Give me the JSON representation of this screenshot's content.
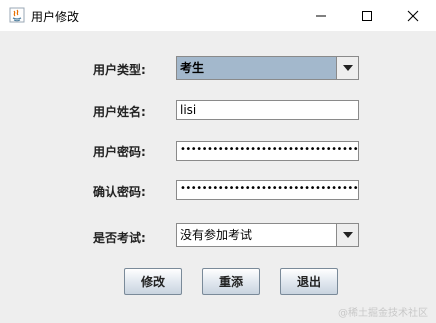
{
  "window": {
    "title": "用户修改",
    "icon": "java-icon",
    "controls": [
      "minimize-icon",
      "maximize-icon",
      "close-icon"
    ]
  },
  "form": {
    "user_type": {
      "label": "用户类型:",
      "value": "考生"
    },
    "user_name": {
      "label": "用户姓名:",
      "value": "lisi"
    },
    "password": {
      "label": "用户密码:",
      "value": "••••••••••••••••••••••••••••••••••••••"
    },
    "confirm_password": {
      "label": "确认密码:",
      "value": "••••••••••••••••••••••••••••••••••••••"
    },
    "exam_status": {
      "label": "是否考试:",
      "value": "没有参加考试"
    }
  },
  "buttons": {
    "modify": "修改",
    "reset": "重添",
    "exit": "退出"
  },
  "watermark": "@稀土掘金技术社区"
}
